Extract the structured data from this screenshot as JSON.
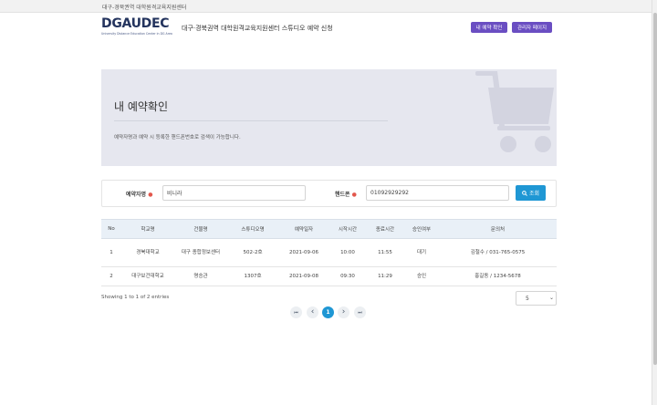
{
  "topbar": {
    "text": "대구-경북권역 대학원격교육지원센터"
  },
  "header": {
    "logo": "DGAUDEC",
    "logo_sub": "University Distance Education Center in DG Area",
    "title": "대구·경북권역 대학원격교육지원센터 스튜디오 예약 신청",
    "btn_reservation": "내 예약 확인",
    "btn_admin": "관리자 페이지"
  },
  "hero": {
    "title": "내 예약확인",
    "description": "예약자명과 예약 시 등록한 핸드폰번호로 검색이 가능합니다.",
    "icon": "shopping-cart-icon"
  },
  "search": {
    "name_label": "예약자명",
    "name_value": "비니라",
    "phone_label": "핸드폰",
    "phone_value": "01092929292",
    "button": "조회",
    "required_mark": "●"
  },
  "table": {
    "columns": [
      "No",
      "학교명",
      "건물명",
      "스튜디오명",
      "예약일자",
      "시작시간",
      "종료시간",
      "승인여부",
      "문의처"
    ],
    "rows": [
      [
        "1",
        "경북대학교",
        "대구 종합정보센터",
        "502-2호",
        "2021-09-06",
        "10:00",
        "11:55",
        "대기",
        "김철수 / 031-765-0575"
      ],
      [
        "2",
        "대구보건대학교",
        "명승관",
        "1307호",
        "2021-09-08",
        "09:30",
        "11:29",
        "승인",
        "홍길동 / 1234-5678"
      ]
    ]
  },
  "pagination": {
    "info": "Showing 1 to 1 of 2 entries",
    "page_size": "5",
    "first": "⏮",
    "prev": "‹",
    "current": "1",
    "next": "›",
    "last": "⏭"
  },
  "colors": {
    "brand_purple": "#6a4ec2",
    "accent_blue": "#1f97d4",
    "logo_navy": "#24345e",
    "hero_bg": "#e6e7ef"
  }
}
